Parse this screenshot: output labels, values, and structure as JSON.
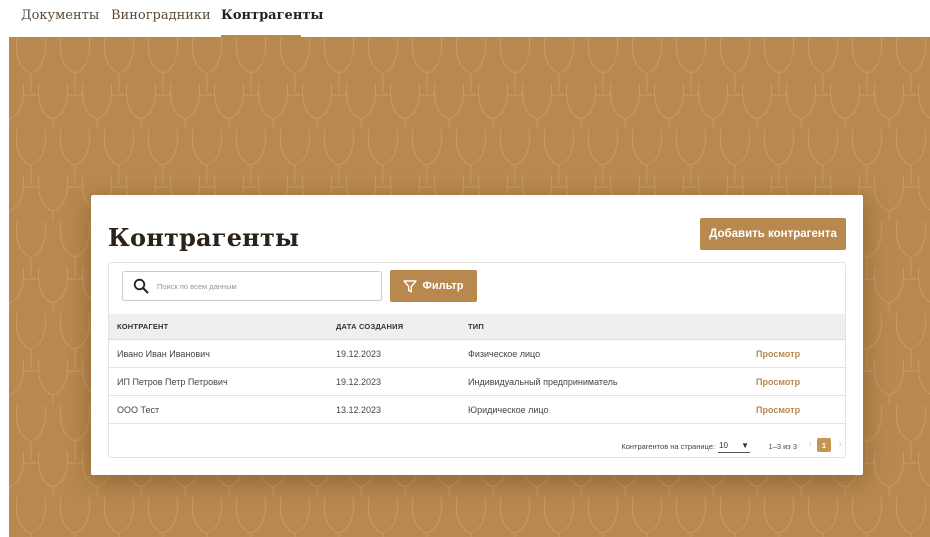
{
  "nav": {
    "items": [
      "Документы",
      "Виноградники",
      "Контрагенты"
    ],
    "active": "Контрагенты"
  },
  "colors": {
    "accent": "#b8884f",
    "banner": "#b8884f",
    "page_active": "#c49452"
  },
  "card": {
    "title": "Контрагенты",
    "add_button": "Добавить контрагента"
  },
  "search": {
    "placeholder": "Поиск по всем данным",
    "icon": "search-icon"
  },
  "filter": {
    "label": "Фильтр",
    "icon": "filter-icon"
  },
  "table": {
    "columns": [
      "КОНТРАГЕНТ",
      "ДАТА СОЗДАНИЯ",
      "ТИП"
    ],
    "rows": [
      {
        "name": "Ивано Иван Иванович",
        "date": "19.12.2023",
        "type": "Физическое лицо",
        "action": "Просмотр"
      },
      {
        "name": "ИП Петров Петр Петрович",
        "date": "19.12.2023",
        "type": "Индивидуальный предприниматель",
        "action": "Просмотр"
      },
      {
        "name": "ООО Тест",
        "date": "13.12.2023",
        "type": "Юридическое лицо",
        "action": "Просмотр"
      }
    ]
  },
  "pagination": {
    "per_page_label": "Контрагентов на странице:",
    "per_page_value": "10",
    "range": "1–3 из 3",
    "current_page": "1"
  }
}
